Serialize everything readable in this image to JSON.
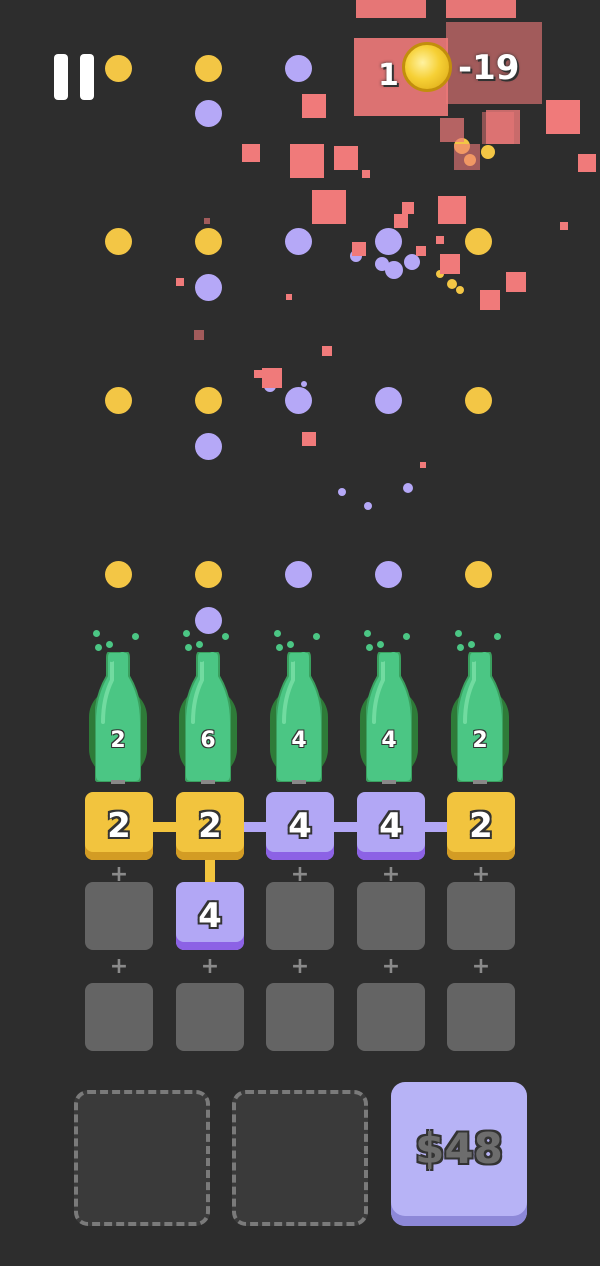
{
  "hud": {
    "coin_text": "-19",
    "coin_prefix": "1"
  },
  "bottles": [
    {
      "value": "2"
    },
    {
      "value": "6"
    },
    {
      "value": "4"
    },
    {
      "value": "4"
    },
    {
      "value": "2"
    }
  ],
  "grid": {
    "row1": [
      {
        "value": "2",
        "color": "yellow"
      },
      {
        "value": "2",
        "color": "yellow"
      },
      {
        "value": "4",
        "color": "purple"
      },
      {
        "value": "4",
        "color": "purple"
      },
      {
        "value": "2",
        "color": "yellow"
      }
    ],
    "row2": [
      {
        "value": "",
        "color": "empty"
      },
      {
        "value": "4",
        "color": "purple"
      },
      {
        "value": "",
        "color": "empty"
      },
      {
        "value": "",
        "color": "empty"
      },
      {
        "value": "",
        "color": "empty"
      }
    ],
    "row3": [
      {
        "value": "",
        "color": "empty"
      },
      {
        "value": "",
        "color": "empty"
      },
      {
        "value": "",
        "color": "empty"
      },
      {
        "value": "",
        "color": "empty"
      },
      {
        "value": "",
        "color": "empty"
      }
    ],
    "plus_symbol": "+"
  },
  "shop": {
    "price": "$48"
  },
  "colors": {
    "background": "#2d2d2d",
    "yellow_tile": "#f2c43e",
    "purple_tile": "#b2a7f5",
    "empty_tile": "#646464",
    "bottle_green": "#4bc684",
    "particle_red": "#f07a7a",
    "dot_yellow": "#f3c645",
    "dot_purple": "#b5a8f7"
  }
}
